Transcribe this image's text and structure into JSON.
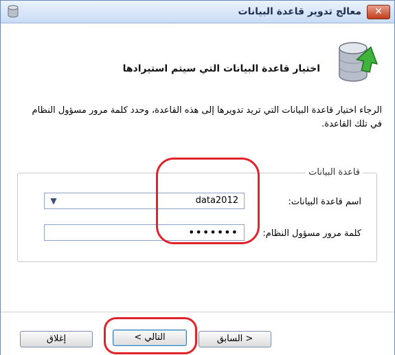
{
  "window": {
    "title": "معالج تدوير قاعدة البيانات",
    "close_label": "✕"
  },
  "header": {
    "title": "اختيار قاعدة البيانات التي سيتم استيرادها"
  },
  "instructions": "الرجاء اختيار قاعدة البيانات التي تريد تدويرها إلى هذه القاعدة، وحدد كلمة مرور مسؤول النظام في تلك القاعدة.",
  "group": {
    "legend": "قاعدة البيانات",
    "db_label": "اسم قاعدة البيانات:",
    "db_value": "data2012",
    "password_label": "كلمة مرور مسؤول النظام:",
    "password_value": "•••••••"
  },
  "buttons": {
    "close": "إغلاق",
    "next": "التالي >",
    "prev": "< السابق"
  },
  "icons": {
    "app": "database-icon",
    "header": "database-import-icon",
    "dropdown": "chevron-down-icon"
  },
  "colors": {
    "highlight": "#e0222b",
    "title_bg": "#c9dcf5",
    "close_bg": "#c23d1c"
  }
}
